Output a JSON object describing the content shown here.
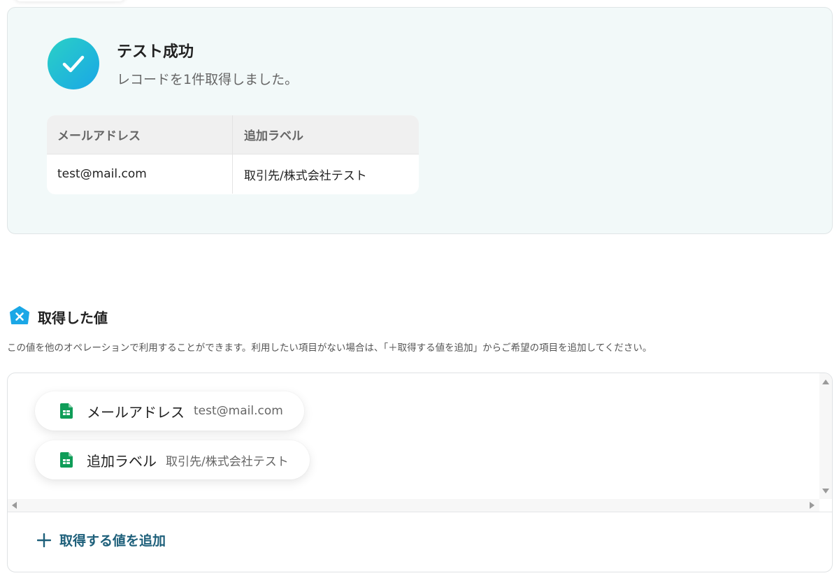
{
  "result": {
    "title": "テスト成功",
    "subtitle": "レコードを1件取得しました。",
    "table": {
      "headers": [
        "メールアドレス",
        "追加ラベル"
      ],
      "rows": [
        [
          "test@mail.com",
          "取引先/株式会社テスト"
        ]
      ]
    }
  },
  "values_section": {
    "title": "取得した値",
    "description": "この値を他のオペレーションで利用することができます。利用したい項目がない場合は、「＋取得する値を追加」からご希望の項目を追加してください。",
    "items": [
      {
        "label": "メールアドレス",
        "value": "test@mail.com",
        "icon": "google-sheets-icon"
      },
      {
        "label": "追加ラベル",
        "value": "取引先/株式会社テスト",
        "icon": "google-sheets-icon"
      }
    ],
    "add_button_label": "取得する値を追加"
  },
  "colors": {
    "accent": "#1d5f7a",
    "success_gradient_start": "#2ad0c6",
    "success_gradient_end": "#1aa7e6",
    "sheets_green": "#0f9d58",
    "badge_blue": "#1aa7e6",
    "card_background": "#f2f9f9"
  }
}
